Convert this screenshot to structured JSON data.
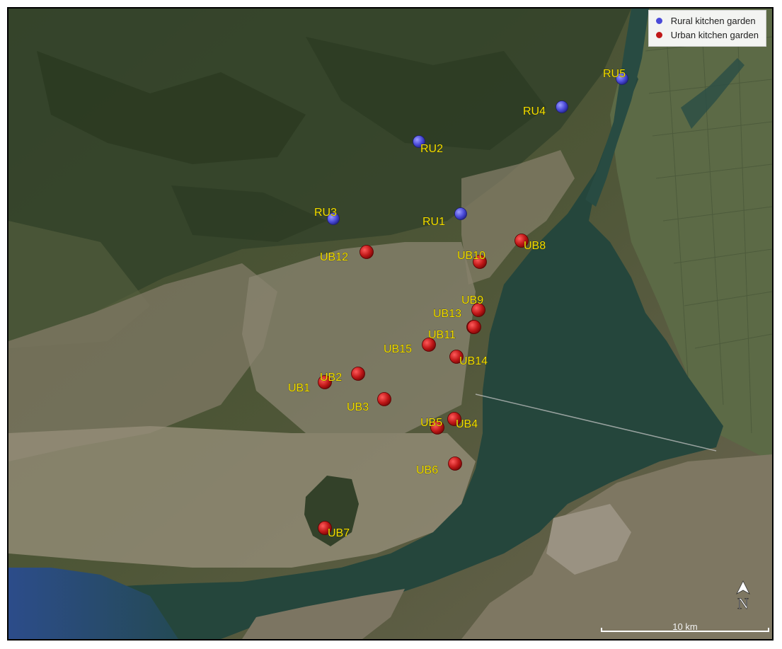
{
  "legend": {
    "items": [
      {
        "label": "Rural kitchen garden",
        "color": "#4a4ad8"
      },
      {
        "label": "Urban kitchen garden",
        "color": "#c01818"
      }
    ]
  },
  "north_arrow": {
    "label": "N"
  },
  "scale_bar": {
    "label": "10 km"
  },
  "markers": [
    {
      "id": "RU1",
      "type": "rural"
    },
    {
      "id": "RU2",
      "type": "rural"
    },
    {
      "id": "RU3",
      "type": "rural"
    },
    {
      "id": "RU4",
      "type": "rural"
    },
    {
      "id": "RU5",
      "type": "rural"
    },
    {
      "id": "UB1",
      "type": "urban"
    },
    {
      "id": "UB2",
      "type": "urban"
    },
    {
      "id": "UB3",
      "type": "urban"
    },
    {
      "id": "UB4",
      "type": "urban"
    },
    {
      "id": "UB5",
      "type": "urban"
    },
    {
      "id": "UB6",
      "type": "urban"
    },
    {
      "id": "UB7",
      "type": "urban"
    },
    {
      "id": "UB8",
      "type": "urban"
    },
    {
      "id": "UB9",
      "type": "urban"
    },
    {
      "id": "UB10",
      "type": "urban"
    },
    {
      "id": "UB11",
      "type": "urban"
    },
    {
      "id": "UB12",
      "type": "urban"
    },
    {
      "id": "UB13",
      "type": "urban"
    },
    {
      "id": "UB14",
      "type": "urban"
    },
    {
      "id": "UB15",
      "type": "urban"
    }
  ],
  "colors": {
    "rural": "#4a4ad8",
    "urban": "#c01818",
    "label": "#f5e000",
    "water": "#25463c",
    "ocean": "#2f4a82"
  }
}
